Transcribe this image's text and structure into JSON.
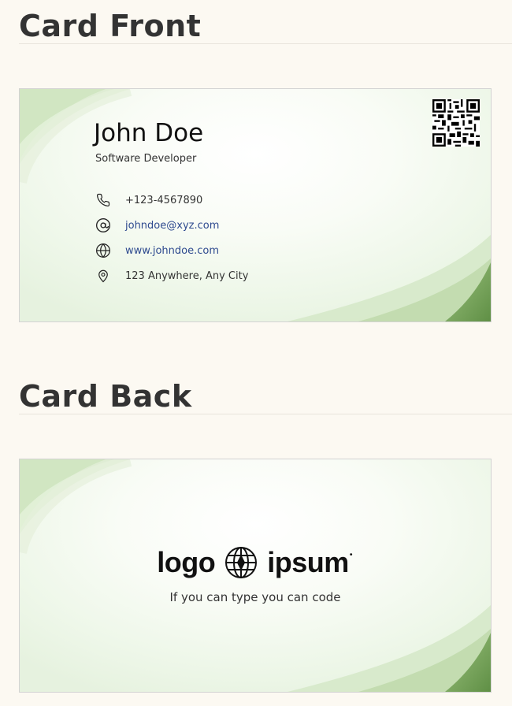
{
  "sections": {
    "front_title": "Card Front",
    "back_title": "Card Back"
  },
  "front": {
    "name": "John Doe",
    "role": "Software Developer",
    "contacts": [
      {
        "icon": "phone-icon",
        "text": "+123-4567890"
      },
      {
        "icon": "at-icon",
        "text": "johndoe@xyz.com"
      },
      {
        "icon": "globe-icon",
        "text": "www.johndoe.com"
      },
      {
        "icon": "location-pin-icon",
        "text": "123 Anywhere, Any City"
      }
    ]
  },
  "back": {
    "logo_left": "logo",
    "logo_right": "ipsum",
    "tagline": "If you can type you can code"
  },
  "colors": {
    "accent_green": "#6e9b52",
    "light_green": "#cfe5c2",
    "link_blue": "#2e4a8f",
    "page_bg": "#fcf9f2"
  }
}
